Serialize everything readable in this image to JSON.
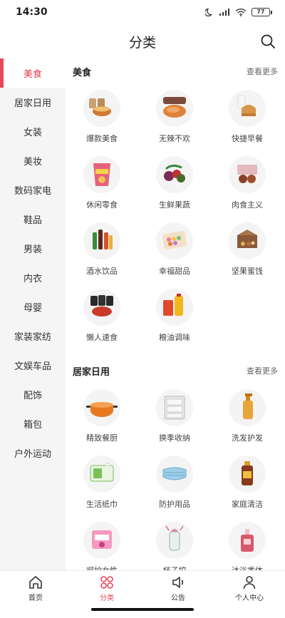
{
  "status_bar": {
    "time": "14:30",
    "battery": "77"
  },
  "header": {
    "title": "分类"
  },
  "sidebar": {
    "items": [
      {
        "label": "美食",
        "active": true
      },
      {
        "label": "居家日用"
      },
      {
        "label": "女装"
      },
      {
        "label": "美妆"
      },
      {
        "label": "数码家电"
      },
      {
        "label": "鞋品"
      },
      {
        "label": "男装"
      },
      {
        "label": "内衣"
      },
      {
        "label": "母婴"
      },
      {
        "label": "家装家纺"
      },
      {
        "label": "文娱车品"
      },
      {
        "label": "配饰"
      },
      {
        "label": "箱包"
      },
      {
        "label": "户外运动"
      }
    ]
  },
  "sections": [
    {
      "title": "美食",
      "more": "查看更多",
      "items": [
        {
          "label": "爆款美食",
          "icon": "noodle-bowl-icon"
        },
        {
          "label": "无辣不欢",
          "icon": "spicy-meat-icon"
        },
        {
          "label": "快捷早餐",
          "icon": "bread-milk-icon"
        },
        {
          "label": "休闲零食",
          "icon": "chips-bag-icon"
        },
        {
          "label": "生鲜果蔬",
          "icon": "fruit-basket-icon"
        },
        {
          "label": "肉食主义",
          "icon": "meat-box-icon"
        },
        {
          "label": "酒水饮品",
          "icon": "bottles-icon"
        },
        {
          "label": "幸福甜品",
          "icon": "macaron-box-icon"
        },
        {
          "label": "坚果蜜饯",
          "icon": "nut-box-icon"
        },
        {
          "label": "懒人速食",
          "icon": "instant-food-icon"
        },
        {
          "label": "粮油调味",
          "icon": "oil-rice-icon"
        }
      ]
    },
    {
      "title": "居家日用",
      "more": "查看更多",
      "items": [
        {
          "label": "精致餐厨",
          "icon": "cooking-pot-icon"
        },
        {
          "label": "换季收纳",
          "icon": "storage-drawer-icon"
        },
        {
          "label": "洗发护发",
          "icon": "shampoo-bottle-icon"
        },
        {
          "label": "生活纸巾",
          "icon": "tissue-pack-icon"
        },
        {
          "label": "防护用品",
          "icon": "face-mask-icon"
        },
        {
          "label": "家庭清洁",
          "icon": "cleaner-bottle-icon"
        },
        {
          "label": "呵护女性",
          "icon": "pad-pack-icon"
        },
        {
          "label": "杯子控",
          "icon": "water-cup-icon"
        },
        {
          "label": "沐浴香体",
          "icon": "perfume-bottle-icon"
        }
      ]
    }
  ],
  "tabbar": {
    "tabs": [
      {
        "label": "首页",
        "icon": "home-icon"
      },
      {
        "label": "分类",
        "icon": "category-icon",
        "active": true
      },
      {
        "label": "公告",
        "icon": "speaker-icon"
      },
      {
        "label": "个人中心",
        "icon": "person-icon"
      }
    ]
  },
  "colors": {
    "accent": "#e8485a",
    "sidebar_bg": "#f5f5f5"
  }
}
